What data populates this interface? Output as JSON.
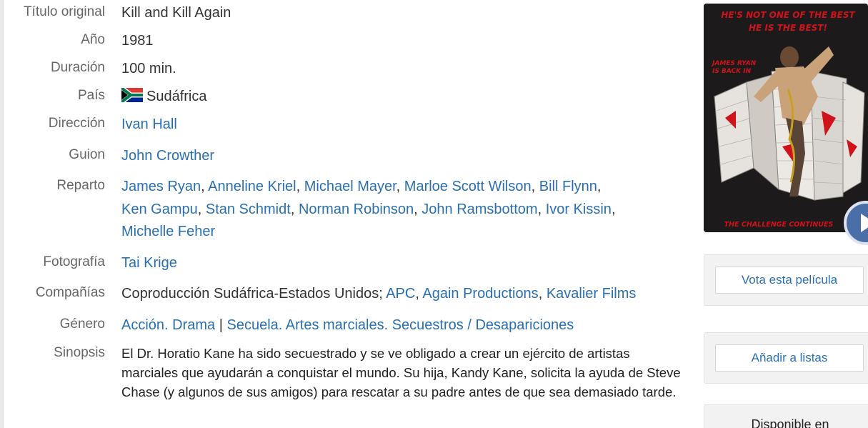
{
  "details": {
    "original_title": {
      "label": "Título original",
      "value": "Kill and Kill Again"
    },
    "year": {
      "label": "Año",
      "value": "1981"
    },
    "duration": {
      "label": "Duración",
      "value": "100 min."
    },
    "country": {
      "label": "País",
      "value": "Sudáfrica",
      "flag_icon": "south-africa-flag-icon"
    },
    "direction": {
      "label": "Dirección",
      "names": [
        "Ivan Hall"
      ]
    },
    "script": {
      "label": "Guion",
      "names": [
        "John Crowther"
      ]
    },
    "cast": {
      "label": "Reparto",
      "names": [
        "James Ryan",
        "Anneline Kriel",
        "Michael Mayer",
        "Marloe Scott Wilson",
        "Bill Flynn",
        "Ken Gampu",
        "Stan Schmidt",
        "Norman Robinson",
        "John Ramsbottom",
        "Ivor Kissin",
        "Michelle Feher"
      ]
    },
    "photography": {
      "label": "Fotografía",
      "names": [
        "Tai Krige"
      ]
    },
    "companies": {
      "label": "Compañías",
      "prefix": "Coproducción Sudáfrica-Estados Unidos; ",
      "names": [
        "APC",
        "Again Productions",
        "Kavalier Films"
      ]
    },
    "genre": {
      "label": "Género",
      "group1": [
        "Acción",
        "Drama"
      ],
      "separator": " | ",
      "group2": [
        "Secuela",
        "Artes marciales",
        "Secuestros / Desapariciones"
      ]
    },
    "synopsis": {
      "label": "Sinopsis",
      "text": "El Dr. Horatio Kane ha sido secuestrado y se ve obligado a crear un ejército de artistas marciales que ayudarán a conquistar el mundo. Su hija, Kandy Kane, solicita la ayuda de Steve Chase (y algunos de sus amigos) para rescatar a su padre antes de que sea demasiado tarde."
    }
  },
  "poster": {
    "tagline_top_1": "HE'S NOT ONE OF THE BEST",
    "tagline_top_2": "HE IS THE BEST!",
    "side_text_1": "JAMES RYAN",
    "side_text_2": "IS BACK IN",
    "tagline_bottom": "THE CHALLENGE CONTINUES",
    "play_icon": "play-icon"
  },
  "sidebar": {
    "vote_button": "Vota esta película",
    "add_lists_button": "Añadir a listas",
    "available_title": "Disponible en"
  },
  "colors": {
    "link": "#2a6fb0",
    "label": "#666666",
    "poster_red": "#d0131b"
  }
}
